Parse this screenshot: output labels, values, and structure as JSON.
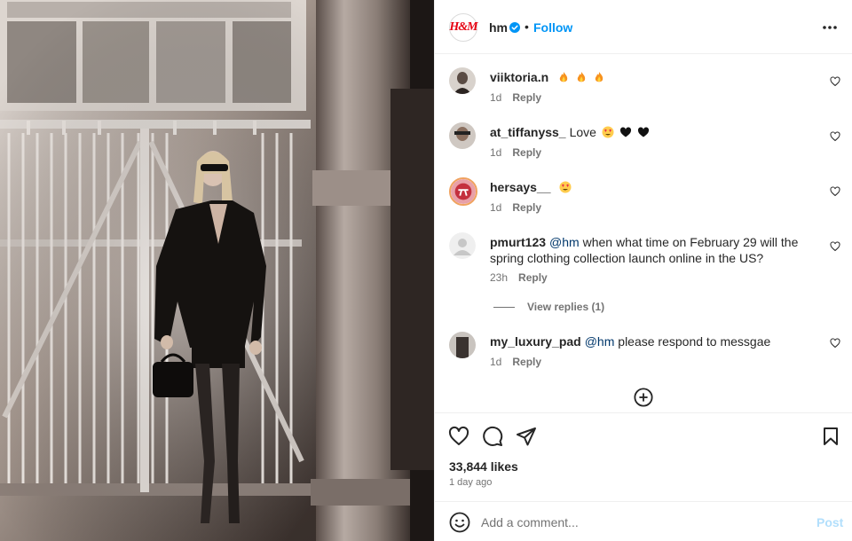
{
  "post": {
    "photo_alt": "Woman in black blazer and sunglasses standing before a metal gate beside a column",
    "header": {
      "username": "hm",
      "separator": "•",
      "follow_label": "Follow",
      "brand_mark": "H&M"
    },
    "comments": [
      {
        "username": "viiktoria.n",
        "mention": "",
        "text": "",
        "emojis": [
          "fire-emoji",
          "fire-emoji",
          "fire-emoji"
        ],
        "age": "1d",
        "reply_label": "Reply"
      },
      {
        "username": "at_tiffanyss_",
        "mention": "",
        "text": "Love",
        "emojis": [
          "heart-eyes-emoji",
          "black-heart-emoji",
          "black-heart-emoji"
        ],
        "age": "1d",
        "reply_label": "Reply"
      },
      {
        "username": "hersays__",
        "mention": "",
        "text": "",
        "emojis": [
          "heart-eyes-emoji"
        ],
        "age": "1d",
        "reply_label": "Reply"
      },
      {
        "username": "pmurt123",
        "mention": "@hm",
        "text": "when what time on February 29 will the spring clothing collection launch online in the US?",
        "emojis": [],
        "age": "23h",
        "reply_label": "Reply"
      },
      {
        "username": "my_luxury_pad",
        "mention": "@hm",
        "text": "please respond to messgae",
        "emojis": [],
        "age": "1d",
        "reply_label": "Reply"
      }
    ],
    "view_replies_label": "View replies (1)",
    "likes": "33,844 likes",
    "time_ago": "1 day ago",
    "add_comment": {
      "placeholder": "Add a comment...",
      "post_label": "Post"
    }
  },
  "colors": {
    "accent": "#0095f6",
    "post_disabled": "#b2dffc",
    "brand_red": "#e50010",
    "text": "#262626",
    "muted": "#737373"
  }
}
